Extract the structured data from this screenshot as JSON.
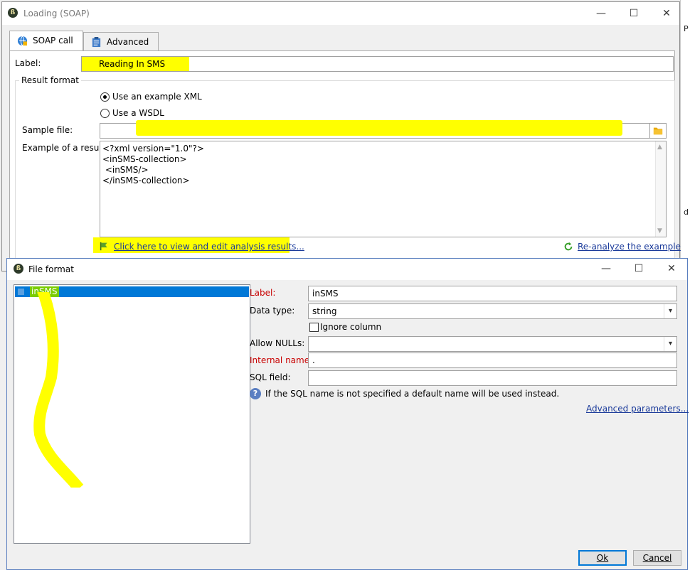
{
  "soap_window": {
    "title": "Loading (SOAP)",
    "controls": {
      "minimize": "—",
      "maximize": "☐",
      "close": "✕"
    },
    "tabs": [
      {
        "label": "SOAP call",
        "active": true
      },
      {
        "label": "Advanced",
        "active": false
      }
    ],
    "label_field": {
      "label": "Label:",
      "value": "Reading In SMS"
    },
    "result_format": {
      "legend": "Result format",
      "options": [
        {
          "label": "Use an example XML",
          "selected": true
        },
        {
          "label": "Use a WSDL",
          "selected": false
        }
      ]
    },
    "sample_file": {
      "label": "Sample file:",
      "value": ""
    },
    "example_result": {
      "label": "Example of a result:",
      "lines": [
        "<?xml version=\"1.0\"?>",
        "<inSMS-collection>",
        " <inSMS/>",
        "</inSMS-collection>"
      ]
    },
    "links": {
      "view_edit": "Click here to view and edit analysis results...",
      "reanalyze": "Re-analyze the example"
    }
  },
  "file_format_window": {
    "title": "File format",
    "controls": {
      "minimize": "—",
      "maximize": "☐",
      "close": "✕"
    },
    "tree": [
      {
        "label": "inSMS",
        "selected": true
      }
    ],
    "fields": {
      "label": {
        "label": "Label:",
        "value": "inSMS"
      },
      "data_type": {
        "label": "Data type:",
        "value": "string"
      },
      "ignore_column": {
        "label": "Ignore column",
        "checked": false
      },
      "allow_nulls": {
        "label": "Allow NULLs:",
        "value": ""
      },
      "internal_name": {
        "label": "Internal name:",
        "value": "."
      },
      "sql_field": {
        "label": "SQL field:",
        "value": ""
      }
    },
    "help_text": "If the SQL name is not specified a default name will be used instead.",
    "advanced_link": "Advanced parameters...",
    "buttons": {
      "ok": "Ok",
      "cancel": "Cancel"
    }
  },
  "background_fragments": [
    "P",
    "d"
  ],
  "colors": {
    "highlight": "#ffff00",
    "selection": "#0078d7",
    "required_label": "#c80000",
    "link": "#1a3a9a"
  },
  "icons": [
    "soap-call-icon",
    "advanced-icon",
    "folder-icon",
    "flag-icon",
    "refresh-icon",
    "help-icon",
    "app-logo-icon"
  ]
}
